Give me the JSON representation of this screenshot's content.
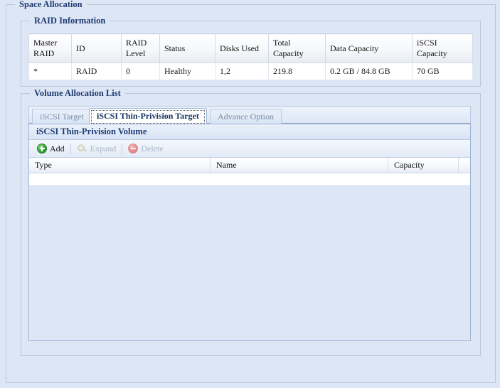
{
  "page": {
    "outer_legend": "Space Allocation",
    "raid_legend": "RAID Information",
    "volume_legend": "Volume Allocation List"
  },
  "raid_table": {
    "columns": [
      "Master RAID",
      "ID",
      "RAID Level",
      "Status",
      "Disks Used",
      "Total Capacity",
      "Data Capacity",
      "iSCSI Capacity"
    ],
    "rows": [
      {
        "master_raid": "*",
        "id": "RAID",
        "raid_level": "0",
        "status": "Healthy",
        "disks_used": "1,2",
        "total_capacity": "219.8",
        "data_capacity": "0.2 GB / 84.8 GB",
        "iscsi_capacity": "70 GB"
      }
    ]
  },
  "tabs": [
    {
      "label": "iSCSI Target",
      "active": false
    },
    {
      "label": "iSCSI Thin-Privision Target",
      "active": true
    },
    {
      "label": "Advance Option",
      "active": false
    }
  ],
  "volume_panel": {
    "title": "iSCSI Thin-Privision Volume",
    "toolbar": [
      {
        "label": "Add",
        "icon": "add-circle-icon",
        "enabled": true
      },
      {
        "label": "Expand",
        "icon": "expand-magnifier-icon",
        "enabled": false
      },
      {
        "label": "Delete",
        "icon": "delete-circle-icon",
        "enabled": false
      }
    ],
    "columns": [
      "Type",
      "Name",
      "Capacity"
    ],
    "rows": []
  },
  "colors": {
    "background": "#dde6f5",
    "legend_text": "#1f3c72",
    "panel_border": "#9db4d4",
    "add_green": "#35a335",
    "delete_red": "#e48c8c"
  }
}
